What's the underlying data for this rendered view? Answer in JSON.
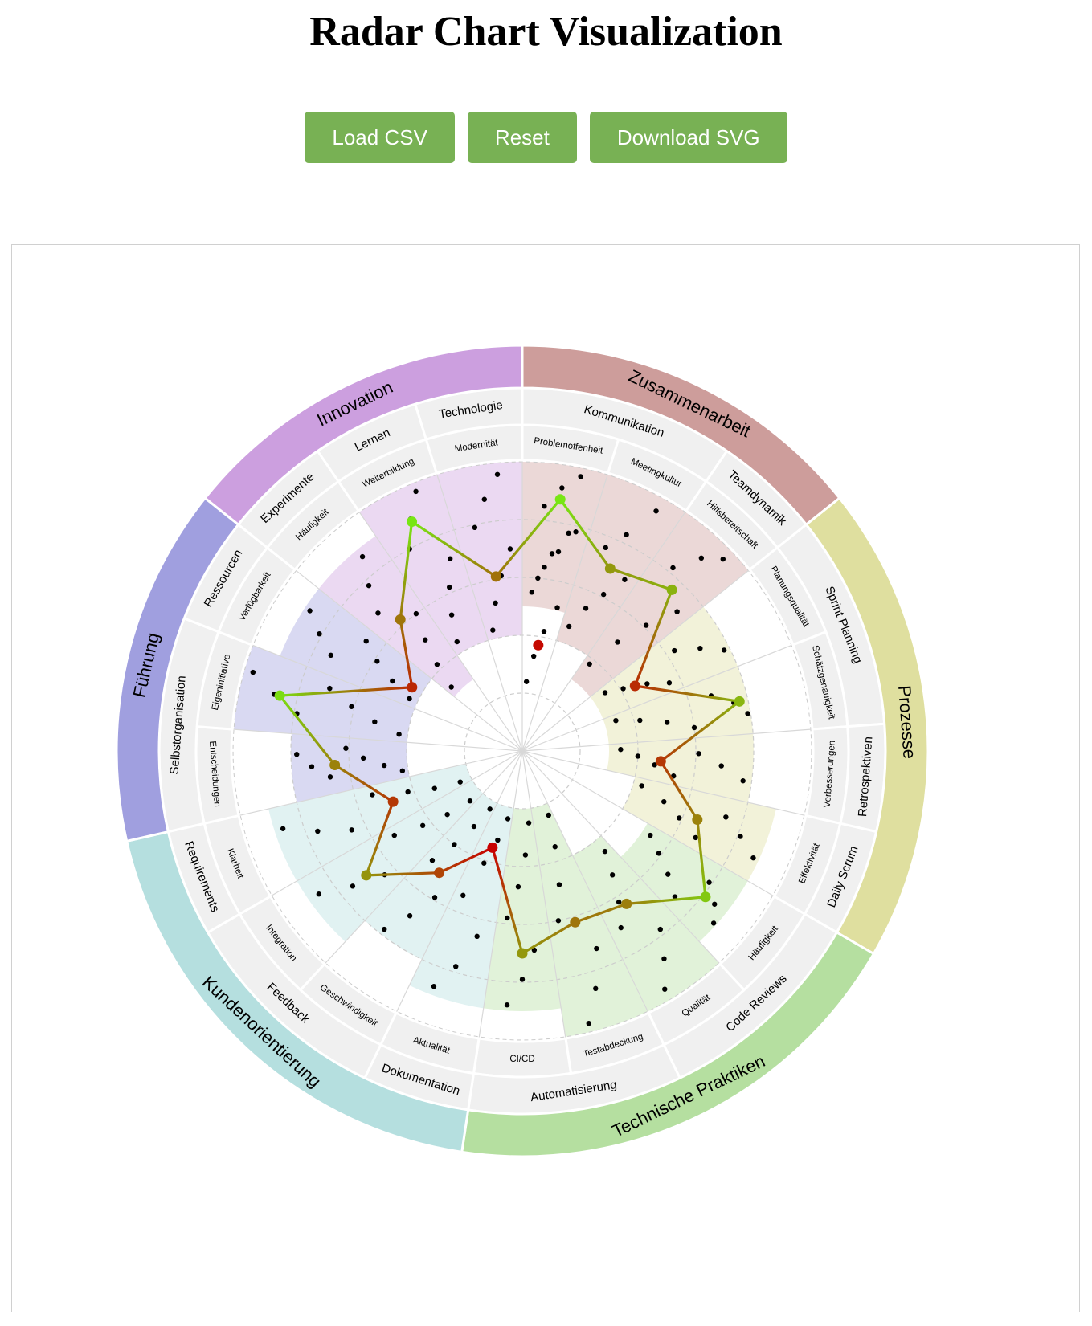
{
  "page": {
    "title": "Radar Chart Visualization"
  },
  "toolbar": {
    "load_label": "Load CSV",
    "reset_label": "Reset",
    "download_label": "Download SVG"
  },
  "chart_data": {
    "type": "radar",
    "rlim": [
      0,
      10
    ],
    "grid": true,
    "categories": [
      {
        "name": "Zusammenarbeit",
        "color": "#cd9d9b",
        "subcategories": [
          {
            "name": "Kommunikation",
            "items": [
              "Problemoffenheit",
              "Meetingkultur"
            ]
          },
          {
            "name": "Teamdynamik",
            "items": [
              "Hilfsbereitschaft"
            ]
          }
        ]
      },
      {
        "name": "Prozesse",
        "color": "#dfdf9f",
        "subcategories": [
          {
            "name": "Sprint Planning",
            "items": [
              "Planungsqualität",
              "Schätzgenauigkeit"
            ]
          },
          {
            "name": "Retrospektiven",
            "items": [
              "Verbesserungen"
            ]
          },
          {
            "name": "Daily Scrum",
            "items": [
              "Effektivität"
            ]
          }
        ]
      },
      {
        "name": "Technische Praktiken",
        "color": "#b5dfa0",
        "subcategories": [
          {
            "name": "Code Reviews",
            "items": [
              "Häufigkeit",
              "Qualität"
            ]
          },
          {
            "name": "Automatisierung",
            "items": [
              "Testabdeckung",
              "CI/CD"
            ]
          }
        ]
      },
      {
        "name": "Kundenorientierung",
        "color": "#b5dfdf",
        "subcategories": [
          {
            "name": "Dokumentation",
            "items": [
              "Aktualität"
            ]
          },
          {
            "name": "Feedback",
            "items": [
              "Geschwindigkeit",
              "Integration"
            ]
          },
          {
            "name": "Requirements",
            "items": [
              "Klarheit"
            ]
          }
        ]
      },
      {
        "name": "Führung",
        "color": "#a09fdf",
        "subcategories": [
          {
            "name": "Selbstorganisation",
            "items": [
              "Entscheidungen",
              "Eigeninitiative"
            ]
          },
          {
            "name": "Ressourcen",
            "items": [
              "Verfügbarkeit"
            ]
          }
        ]
      },
      {
        "name": "Innovation",
        "color": "#cc9fdf",
        "subcategories": [
          {
            "name": "Experimente",
            "items": [
              "Häufigkeit"
            ]
          },
          {
            "name": "Lernen",
            "items": [
              "Weiterbildung"
            ]
          },
          {
            "name": "Technologie",
            "items": [
              "Modernität"
            ]
          }
        ]
      }
    ],
    "averages": [
      8.8,
      7.0,
      7.6,
      4.5,
      7.7,
      4.8,
      6.5,
      8.1,
      6.4,
      6.2,
      7.0,
      3.5,
      5.1,
      6.9,
      4.8,
      6.5,
      8.6,
      4.4,
      6.2,
      8.8,
      6.1,
      3.7
    ],
    "ranges": [
      [
        5,
        10
      ],
      [
        4,
        10
      ],
      [
        3,
        10
      ],
      [
        3,
        8
      ],
      [
        3,
        8
      ],
      [
        3,
        8
      ],
      [
        4,
        9
      ],
      [
        5,
        9
      ],
      [
        4,
        10
      ],
      [
        2,
        10
      ],
      [
        2,
        9
      ],
      [
        2,
        9
      ],
      [
        2,
        8
      ],
      [
        2,
        9
      ],
      [
        2,
        9
      ],
      [
        4,
        8
      ],
      [
        4,
        10
      ],
      [
        4,
        9
      ],
      [
        3,
        9
      ],
      [
        4,
        10
      ],
      [
        4,
        10
      ],
      [
        2,
        8
      ]
    ],
    "responses": [
      [
        5.5,
        6.4,
        7.0,
        7.8,
        8.5,
        9.2,
        9.7
      ],
      [
        4.6,
        5.4,
        6.1,
        6.9,
        7.6,
        8.3,
        9.5
      ],
      [
        3.8,
        5.0,
        6.1,
        7.2,
        8.2,
        9.1,
        9.6
      ],
      [
        3.5,
        4.1,
        4.9,
        5.6,
        6.3,
        7.1,
        7.8
      ],
      [
        3.4,
        4.2,
        5.1,
        6.0,
        6.8,
        7.5,
        7.9
      ],
      [
        3.4,
        4.0,
        4.6,
        5.3,
        6.1,
        6.9,
        7.7
      ],
      [
        4.3,
        5.2,
        5.9,
        6.7,
        7.4,
        8.1,
        8.8
      ],
      [
        5.3,
        5.9,
        6.6,
        7.3,
        7.9,
        8.5,
        8.9
      ],
      [
        4.5,
        5.3,
        6.2,
        7.0,
        7.8,
        8.7,
        9.6
      ],
      [
        2.4,
        3.5,
        4.8,
        6.0,
        7.3,
        8.6,
        9.7
      ],
      [
        2.5,
        3.6,
        4.7,
        5.8,
        6.9,
        7.9,
        8.8
      ],
      [
        2.4,
        3.2,
        4.1,
        5.4,
        6.6,
        7.8,
        8.7
      ],
      [
        2.3,
        3.1,
        4.0,
        4.9,
        5.9,
        6.9,
        7.8
      ],
      [
        2.5,
        3.4,
        4.3,
        5.3,
        6.4,
        7.5,
        8.6
      ],
      [
        2.4,
        3.3,
        4.2,
        5.4,
        6.5,
        7.6,
        8.7
      ],
      [
        4.2,
        4.8,
        5.5,
        6.1,
        6.7,
        7.3,
        7.8
      ],
      [
        4.3,
        5.2,
        6.1,
        7.0,
        7.9,
        8.8,
        9.7
      ],
      [
        4.3,
        5.1,
        5.9,
        6.6,
        7.4,
        8.1,
        8.8
      ],
      [
        3.3,
        4.2,
        5.1,
        6.0,
        6.9,
        7.8,
        8.7
      ],
      [
        4.4,
        5.3,
        6.2,
        7.1,
        8.0,
        8.9,
        9.7
      ],
      [
        4.3,
        5.2,
        6.1,
        7.0,
        7.9,
        8.8,
        9.6
      ],
      [
        2.4,
        3.3,
        4.2,
        5.1,
        6.0,
        6.9,
        7.7
      ]
    ]
  }
}
